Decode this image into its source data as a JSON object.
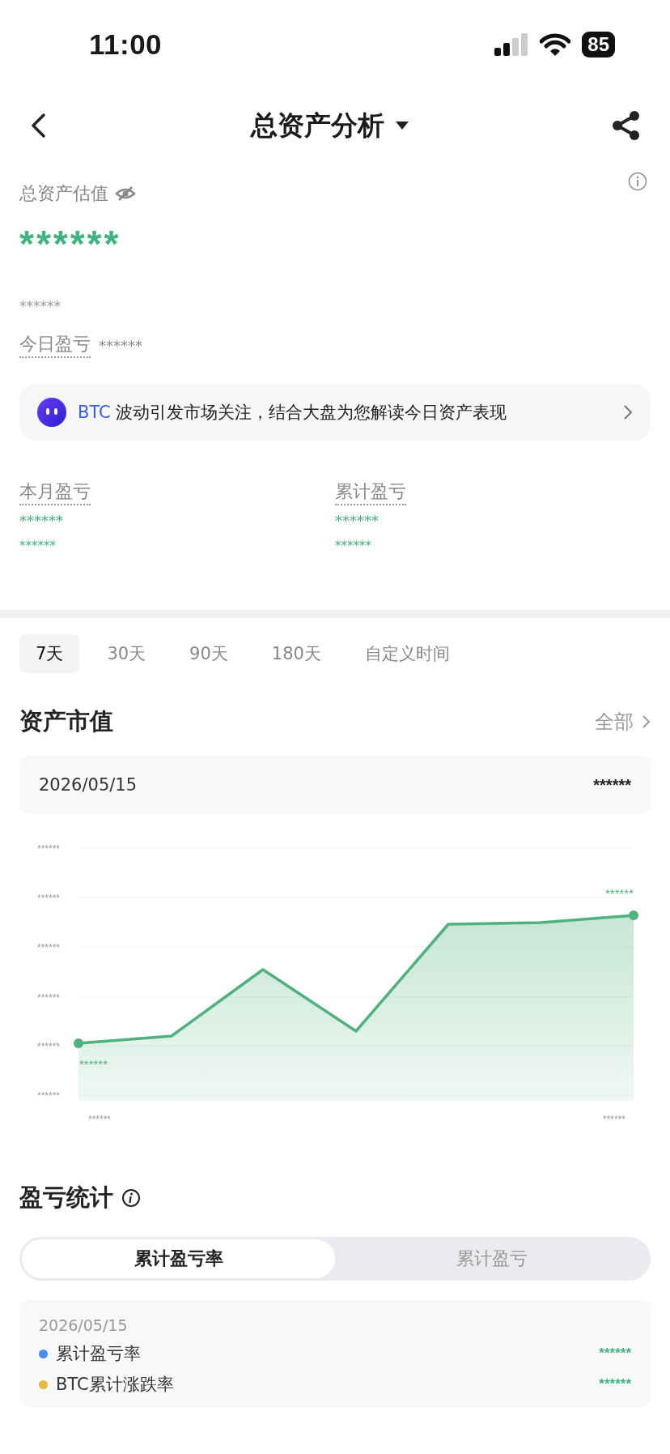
{
  "status_bar": {
    "time": "11:00",
    "battery": "85"
  },
  "nav": {
    "title": "总资产分析"
  },
  "summary": {
    "label": "总资产估值",
    "value": "******",
    "sub_value": "******",
    "today_label": "今日盈亏",
    "today_value": "******"
  },
  "banner": {
    "tag": "BTC",
    "text": "波动引发市场关注，结合大盘为您解读今日资产表现"
  },
  "pnl_cards": [
    {
      "label": "本月盈亏",
      "value": "******",
      "rate": "******"
    },
    {
      "label": "累计盈亏",
      "value": "******",
      "rate": "******"
    }
  ],
  "period_tabs": [
    {
      "label": "7天",
      "selected": true
    },
    {
      "label": "30天",
      "selected": false
    },
    {
      "label": "90天",
      "selected": false
    },
    {
      "label": "180天",
      "selected": false
    },
    {
      "label": "自定义时间",
      "selected": false
    }
  ],
  "market_value": {
    "title": "资产市值",
    "link": "全部",
    "date": "2026/05/15",
    "value": "******",
    "y_labels": [
      "******",
      "******",
      "******",
      "******",
      "******",
      "******"
    ],
    "start_label": "******",
    "end_label": "******",
    "x_labels": [
      "******",
      "******"
    ]
  },
  "pnl_stats": {
    "title": "盈亏统计",
    "segments": [
      {
        "label": "累计盈亏率",
        "selected": true
      },
      {
        "label": "累计盈亏",
        "selected": false
      }
    ],
    "date": "2026/05/15",
    "rows": [
      {
        "name": "累计盈亏率",
        "color": "#4a8cf7",
        "value": "******"
      },
      {
        "name": "BTC累计涨跌率",
        "color": "#e8b93a",
        "value": "******"
      }
    ]
  }
}
